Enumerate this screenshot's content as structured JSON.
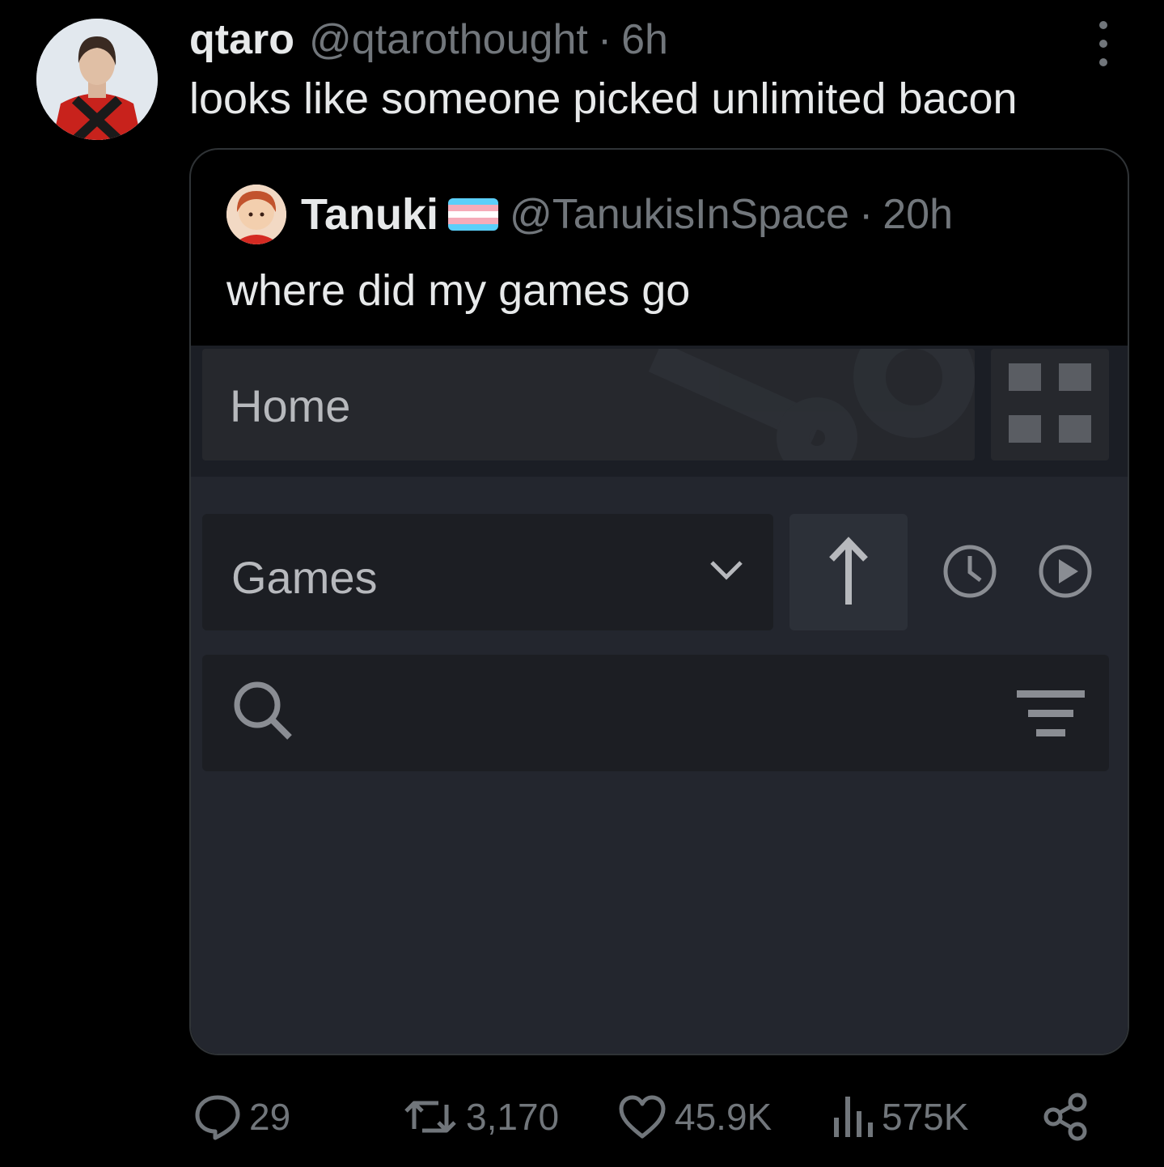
{
  "tweet": {
    "display_name": "qtaro",
    "handle": "@qtarothought",
    "separator": "·",
    "time": "6h",
    "text": "looks like someone picked unlimited bacon"
  },
  "quoted": {
    "display_name": "Tanuki",
    "handle": "@TanukisInSpace",
    "separator": "·",
    "time": "20h",
    "text": "where did my games go",
    "screenshot": {
      "home_label": "Home",
      "collection_label": "Games"
    }
  },
  "actions": {
    "replies": "29",
    "retweets": "3,170",
    "likes": "45.9K",
    "views": "575K"
  },
  "colors": {
    "background": "#000000",
    "text": "#e7e9ea",
    "muted": "#71767b",
    "card_border": "#2f3336",
    "steam_bg": "#23262e"
  },
  "icons": [
    "more-icon",
    "trans-flag-icon",
    "grid-view-icon",
    "chevron-down-icon",
    "sort-up-arrow-icon",
    "clock-icon",
    "play-icon",
    "search-icon",
    "filter-icon",
    "reply-icon",
    "retweet-icon",
    "like-icon",
    "views-icon",
    "share-icon"
  ]
}
